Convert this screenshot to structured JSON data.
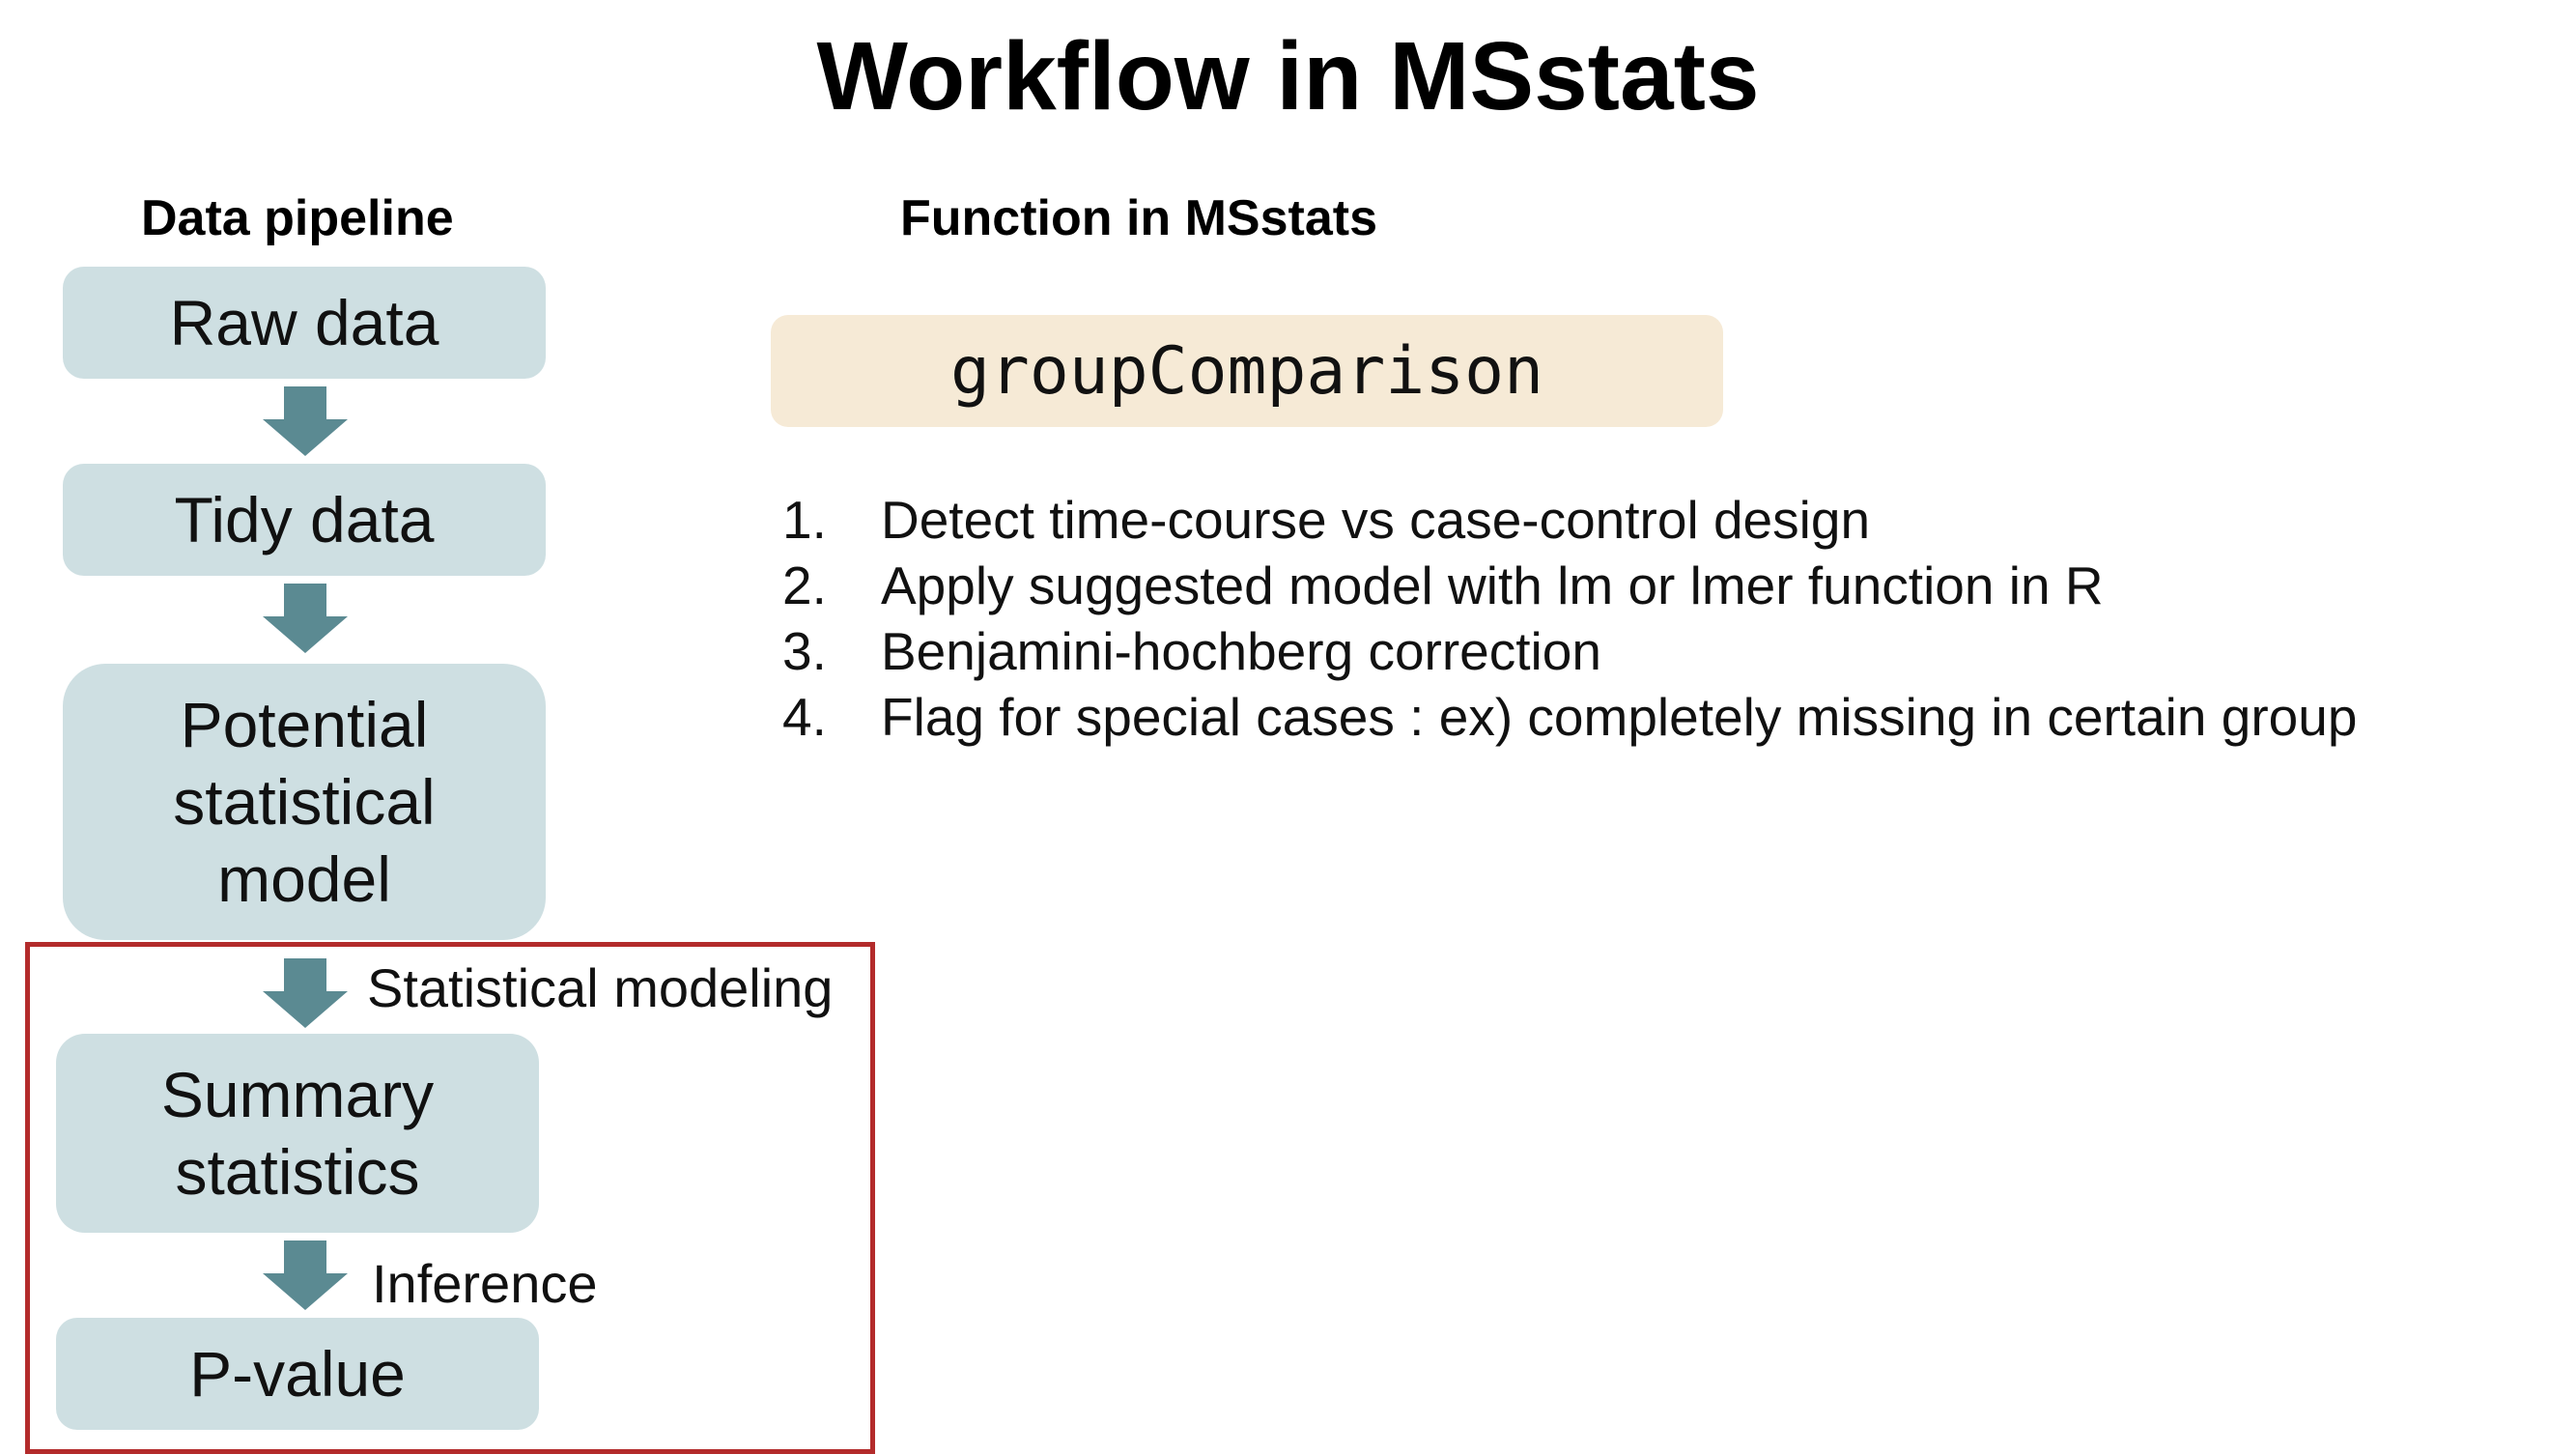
{
  "title": "Workflow in MSstats",
  "headings": {
    "pipeline": "Data pipeline",
    "function": "Function in MSstats"
  },
  "pipeline": {
    "raw": "Raw data",
    "tidy": "Tidy data",
    "model_lines": [
      "Potential",
      "statistical",
      "model"
    ],
    "summary_lines": [
      "Summary",
      "statistics"
    ],
    "pvalue": "P-value"
  },
  "arrow_labels": {
    "modeling": "Statistical modeling",
    "inference": "Inference"
  },
  "function_name": "groupComparison",
  "steps": [
    {
      "num": "1.",
      "text": "Detect time-course vs case-control design"
    },
    {
      "num": "2.",
      "text": "Apply suggested model with lm or lmer function in R"
    },
    {
      "num": "3.",
      "text": "Benjamini-hochberg correction"
    },
    {
      "num": "4.",
      "text": "Flag for special cases : ex) completely missing in certain group"
    }
  ],
  "colors": {
    "pipeline_box": "#cedfe2",
    "arrow": "#5b8a92",
    "function_box": "#f6ead6",
    "frame": "#b32b2b"
  }
}
